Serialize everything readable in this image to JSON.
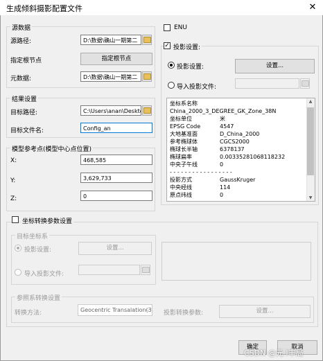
{
  "window": {
    "title": "生成倾斜摄影配置文件",
    "close_glyph": "✕"
  },
  "source": {
    "group_label": "源数据",
    "source_path_label": "源路径:",
    "source_path_value": "D:\\数据\\确山一期第二",
    "root_node_label": "指定根节点",
    "root_node_button": "指定根节点",
    "metadata_label": "元数据:",
    "metadata_value": "D:\\数据\\确山一期第二"
  },
  "result": {
    "group_label": "结果设置",
    "target_path_label": "目标路径:",
    "target_path_value": "C:\\Users\\anan\\Desktop",
    "target_filename_label": "目标文件名:",
    "target_filename_value": "Config_an"
  },
  "model_ref": {
    "group_label": "模型参考点(模型中心点位置)",
    "x_label": "X:",
    "x_value": "468,585",
    "y_label": "Y:",
    "y_value": "3,629,733",
    "z_label": "Z:",
    "z_value": "0"
  },
  "right": {
    "enu_label": "ENU",
    "proj_group_label": "投影设置:",
    "proj_radio_label": "投影设置:",
    "proj_button": "设置...",
    "import_radio_label": "导入投影文件:",
    "info_rows": [
      {
        "k": "坐标系名称",
        "v": ""
      },
      {
        "k": "China_2000_3_DEGREE_GK_Zone_38N",
        "v": ""
      },
      {
        "k": "坐标单位",
        "v": "米"
      },
      {
        "k": "EPSG Code",
        "v": "4547"
      },
      {
        "k": "大地基准面",
        "v": "D_China_2000"
      },
      {
        "k": "参考椭球体",
        "v": "CGCS2000"
      },
      {
        "k": "椭球长半轴",
        "v": "6378137"
      },
      {
        "k": "椭球扁率",
        "v": "0.00335281068118232"
      },
      {
        "k": "中央子午线",
        "v": "0"
      },
      {
        "k": "- - - - - - - - - - - - - - - - -",
        "v": ""
      },
      {
        "k": "投影方式",
        "v": "GaussKruger"
      },
      {
        "k": "中央经线",
        "v": "114"
      },
      {
        "k": "原点纬线",
        "v": "0"
      }
    ]
  },
  "transform": {
    "checkbox_label": "坐标转换参数设置",
    "target_crs_label": "目标坐标系",
    "proj_radio_label": "投影设置:",
    "proj_button": "设置...",
    "import_radio_label": "导入投影文件:",
    "ref_group_label": "参照系转换设置",
    "method_label": "转换方法:",
    "method_value": "Geocentric Transalation(3-",
    "params_label": "投影转换参数:",
    "params_button": "设置..."
  },
  "footer": {
    "ok_button": "确定",
    "cancel_button": "取消",
    "watermark": "CSDN @元 Ⅰ丰局"
  }
}
